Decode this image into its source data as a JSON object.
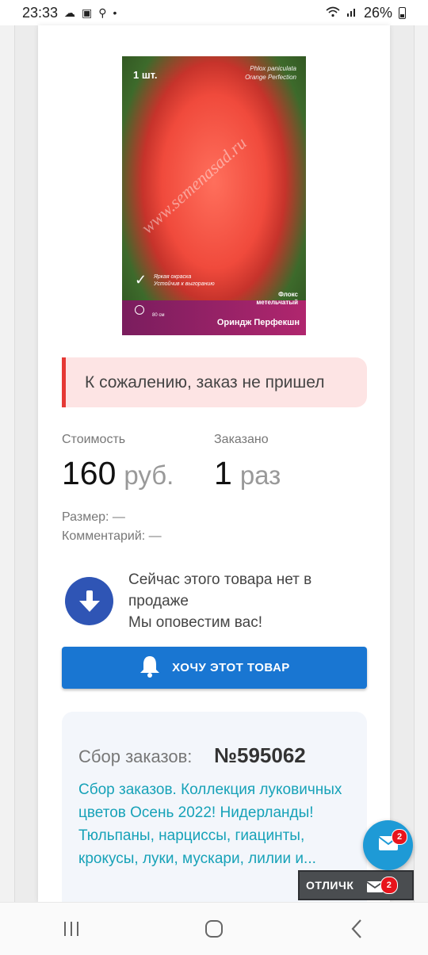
{
  "status_bar": {
    "time": "23:33",
    "battery": "26%"
  },
  "product_image": {
    "count": "1 шт.",
    "latin_name_1": "Phlox paniculata",
    "latin_name_2": "Orange Perfection",
    "watermark": "www.semenasad.ru",
    "promo_1": "Яркая окраска",
    "promo_2": "Устойчив к выгоранию",
    "species_1": "Флокс",
    "species_2": "метельчатый",
    "variety": "Ориндж Перфекшн",
    "height": "80 см"
  },
  "alert": {
    "text": "К сожалению, заказ не пришел"
  },
  "stats": {
    "cost_label": "Стоимость",
    "cost_value": "160",
    "cost_unit": "руб.",
    "ordered_label": "Заказано",
    "ordered_value": "1",
    "ordered_unit": "раз"
  },
  "meta": {
    "size": "Размер: —",
    "comment": "Комментарий: —"
  },
  "notify": {
    "line1": "Сейчас этого товара нет в продаже",
    "line2": "Мы оповестим вас!"
  },
  "want_button": {
    "label": "ХОЧУ ЭТОТ ТОВАР"
  },
  "collection": {
    "label": "Сбор заказов:",
    "number": "№595062",
    "link_text": "Сбор заказов. Коллекция луковичных цветов Осень 2022! Нидерланды! Тюльпаны, нарциссы, гиацинты, крокусы, луки, мускари, лилии и..."
  },
  "fab": {
    "badge": "2"
  },
  "diff_bar": {
    "label": "ОТЛИЧК",
    "badge": "2"
  },
  "colors": {
    "accent": "#1976d2",
    "link": "#17a2b8",
    "alert_bg": "#fde4e4",
    "alert_border": "#e53935",
    "badge": "#e8141c"
  }
}
